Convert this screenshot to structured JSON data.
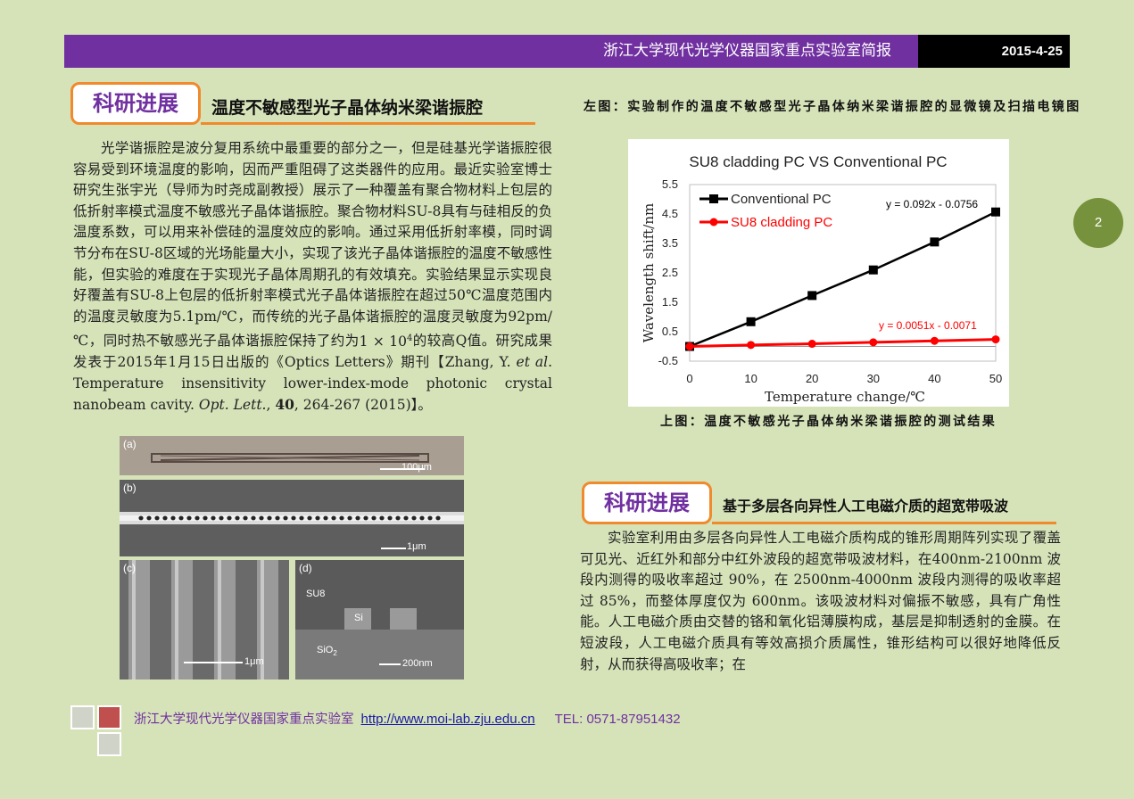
{
  "header": {
    "title": "浙江大学现代光学仪器国家重点实验室简报",
    "date": "2015-4-25"
  },
  "page_number": "2",
  "section1": {
    "badge": "科研进展",
    "title": "温度不敏感型光子晶体纳米梁谐振腔",
    "body_parts": {
      "p1": "光学谐振腔是波分复用系统中最重要的部分之一，但是硅基光学谐振腔很容易受到环境温度的影响，因而严重阻碍了这类器件的应用。最近实验室博士研究生张宇光（导师为时尧成副教授）展示了一种覆盖有聚合物材料上包层的低折射率模式温度不敏感光子晶体谐振腔。聚合物材料SU-8具有与硅相反的负温度系数，可以用来补偿硅的温度效应的影响。通过采用低折射率模，同时调节分布在SU-8区域的光场能量大小，实现了该光子晶体谐振腔的温度不敏感性能，但实验的难度在于实现光子晶体周期孔的有效填充。实验结果显示实现良好覆盖有SU-8上包层的低折射率模式光子晶体谐振腔在超过50℃温度范围内的温度灵敏度为5.1pm/℃，而传统的光子晶体谐振腔的温度灵敏度为92pm/℃，同时热不敏感光子晶体谐振腔保持了约为",
      "q_base": "1 × 10",
      "q_exp": "4",
      "p2": "的较高Q值。研究成果发表于2015年1月15日出版的《Optics Letters》期刊【Zhang, Y. ",
      "etal": "et al",
      "p3": ". Temperature insensitivity lower-index-mode photonic crystal nanobeam cavity. ",
      "journal": "Opt. Lett.",
      "p4": ", ",
      "volume": "40",
      "p5": ", 264-267 (2015)】。"
    }
  },
  "micrographs": {
    "a": {
      "letter": "(a)",
      "scale": "100μm"
    },
    "b": {
      "letter": "(b)",
      "scale": "1μm"
    },
    "c": {
      "letter": "(c)",
      "scale": "1μm"
    },
    "d": {
      "letter": "(d)",
      "scale": "200nm",
      "label_su8": "SU8",
      "label_si": "Si",
      "label_sio2": "SiO",
      "label_sio2_sub": "2"
    }
  },
  "captions": {
    "left_figure": "左图：实验制作的温度不敏感型光子晶体纳米梁谐振腔的显微镜及扫描电镜图",
    "top_figure": "上图：温度不敏感光子晶体纳米梁谐振腔的测试结果"
  },
  "chart_data": {
    "type": "line",
    "title": "SU8 cladding PC VS Conventional PC",
    "xlabel": "Temperature change/℃",
    "ylabel": "Wavelength shift/nm",
    "x": [
      0,
      10,
      20,
      30,
      40,
      50
    ],
    "xlim": [
      0,
      50
    ],
    "ylim": [
      -0.5,
      5.5
    ],
    "xticks": [
      "0",
      "10",
      "20",
      "30",
      "40",
      "50"
    ],
    "yticks": [
      "-0.5",
      "0.5",
      "1.5",
      "2.5",
      "3.5",
      "4.5",
      "5.5"
    ],
    "grid": false,
    "legend_position": "top-left",
    "series": [
      {
        "name": "Conventional PC",
        "color": "#000000",
        "marker": "square",
        "values": [
          0.0,
          0.84,
          1.73,
          2.6,
          3.55,
          4.57
        ],
        "trendline": "y = 0.092x - 0.0756"
      },
      {
        "name": "SU8 cladding PC",
        "color": "#ff0000",
        "marker": "circle",
        "values": [
          0.0,
          0.05,
          0.09,
          0.14,
          0.19,
          0.24
        ],
        "trendline": "y = 0.0051x - 0.0071"
      }
    ]
  },
  "section2": {
    "badge": "科研进展",
    "title": "基于多层各向异性人工电磁介质的超宽带吸波",
    "body": "实验室利用由多层各向异性人工电磁介质构成的锥形周期阵列实现了覆盖可见光、近红外和部分中红外波段的超宽带吸波材料，在400nm-2100nm 波段内测得的吸收率超过 90%，在 2500nm-4000nm 波段内测得的吸收率超过 85%，而整体厚度仅为 600nm。该吸波材料对偏振不敏感，具有广角性能。人工电磁介质由交替的铬和氧化铝薄膜构成，基层是抑制透射的金膜。在短波段，人工电磁介质具有等效高损介质属性，锥形结构可以很好地降低反射，从而获得高吸收率；在"
  },
  "footer": {
    "org": "浙江大学现代光学仪器国家重点实验室",
    "url": "http://www.moi-lab.zju.edu.cn",
    "tel": "TEL: 0571-87951432",
    "colors": {
      "square_grey": "#d0d4c8",
      "square_red": "#c0504d"
    }
  }
}
